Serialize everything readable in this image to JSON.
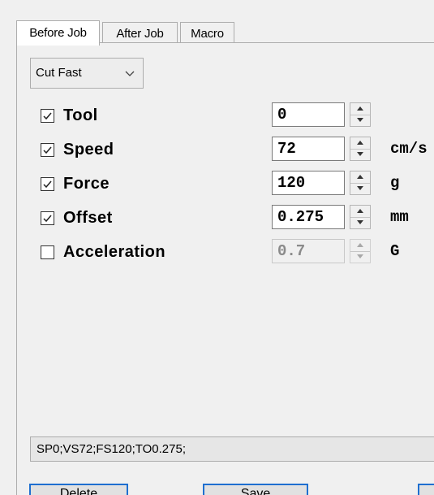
{
  "tabs": [
    {
      "label": "Before Job",
      "active": true
    },
    {
      "label": "After Job",
      "active": false
    },
    {
      "label": "Macro",
      "active": false
    }
  ],
  "preset": {
    "selected": "Cut Fast",
    "icon": "chevron-down-icon"
  },
  "settings": [
    {
      "label": "Tool",
      "checked": true,
      "value": "0",
      "unit": "",
      "enabled": true
    },
    {
      "label": "Speed",
      "checked": true,
      "value": "72",
      "unit": "cm/s",
      "enabled": true
    },
    {
      "label": "Force",
      "checked": true,
      "value": "120",
      "unit": "g",
      "enabled": true
    },
    {
      "label": "Offset",
      "checked": true,
      "value": "0.275",
      "unit": "mm",
      "enabled": true
    },
    {
      "label": "Acceleration",
      "checked": false,
      "value": "0.7",
      "unit": "G",
      "enabled": false
    }
  ],
  "command_output": "SP0;VS72;FS120;TO0.275;",
  "buttons": {
    "delete_label": "Delete",
    "save_label": "Save"
  },
  "colors": {
    "accent_border": "#1e6fd0",
    "disabled_text": "#8a8a8a",
    "panel_bg": "#f0f0f0"
  }
}
